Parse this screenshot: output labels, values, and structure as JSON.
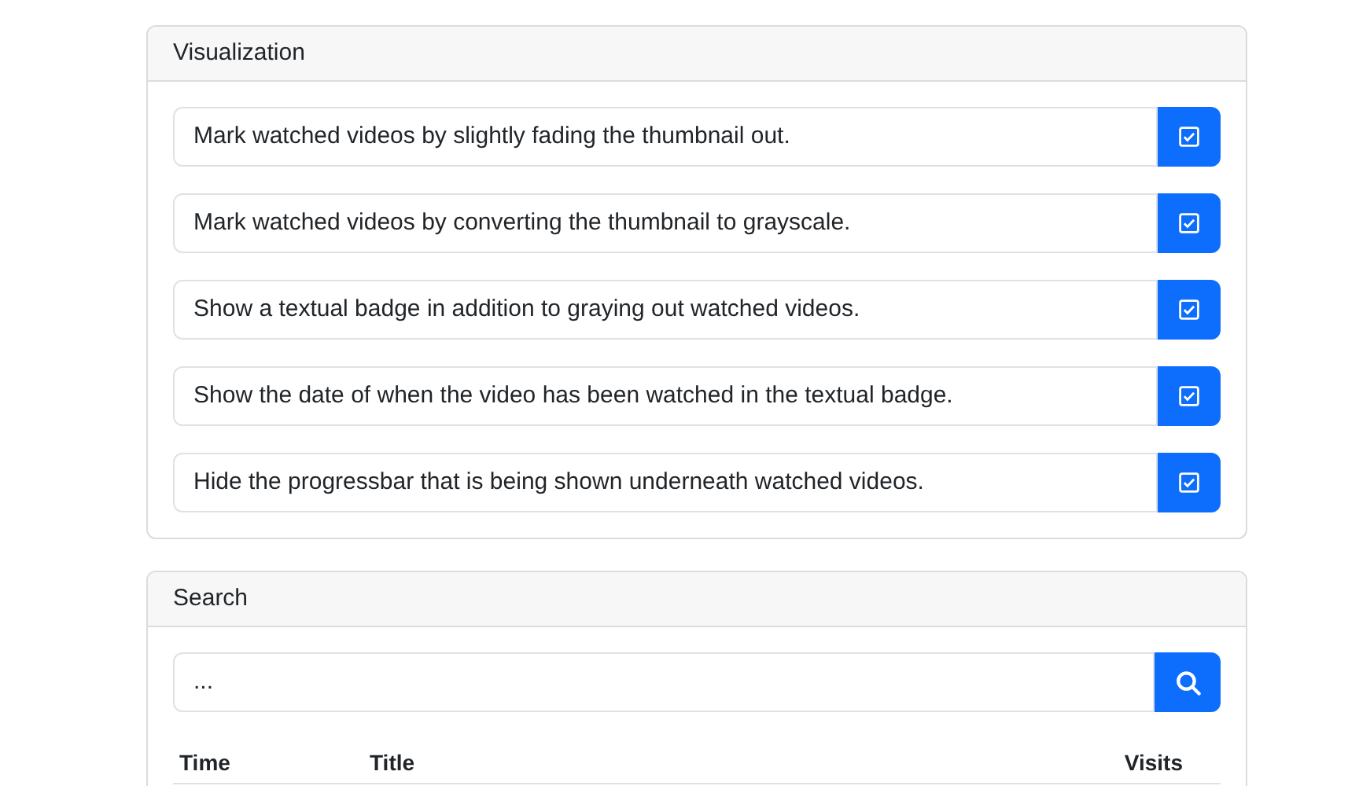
{
  "visualization": {
    "title": "Visualization",
    "options": [
      {
        "label": "Mark watched videos by slightly fading the thumbnail out.",
        "checked": true
      },
      {
        "label": "Mark watched videos by converting the thumbnail to grayscale.",
        "checked": true
      },
      {
        "label": "Show a textual badge in addition to graying out watched videos.",
        "checked": true
      },
      {
        "label": "Show the date of when the video has been watched in the textual badge.",
        "checked": true
      },
      {
        "label": "Hide the progressbar that is being shown underneath watched videos.",
        "checked": true
      }
    ]
  },
  "search": {
    "title": "Search",
    "value": "...",
    "table": {
      "columns": [
        "Time",
        "Title",
        "Visits"
      ]
    }
  }
}
